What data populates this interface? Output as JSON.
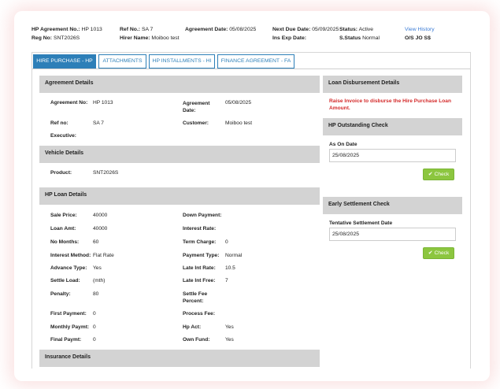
{
  "header": {
    "agreement_no_label": "HP Agreement No.:",
    "agreement_no": "HP 1013",
    "ref_no_label": "Ref No.:",
    "ref_no": "SA 7",
    "agreement_date_label": "Agreement Date:",
    "agreement_date": "05/08/2025",
    "next_due_label": "Next Due Date:",
    "next_due": "05/09/2025",
    "status_label": "Status:",
    "status": "Active",
    "view_history": "View History",
    "reg_no_label": "Reg No:",
    "reg_no": "SNT2026S",
    "hirer_label": "Hirer Name:",
    "hirer": "Moiboo test",
    "ins_exp_label": "Ins Exp Date:",
    "ins_exp": "",
    "s_status_label": "S.Status",
    "s_status": "Normal",
    "os_label": "O/S JO S$"
  },
  "tabs": [
    {
      "label": "HIRE PURCHASE - HP",
      "active": true
    },
    {
      "label": "ATTACHMENTS",
      "active": false
    },
    {
      "label": "HP INSTALLMENTS - HI",
      "active": false
    },
    {
      "label": "FINANCE AGREEMENT - FA",
      "active": false
    }
  ],
  "agreement_details": {
    "title": "Agreement Details",
    "agreement_no_label": "Agreement No:",
    "agreement_no": "HP 1013",
    "agreement_date_label": "Agreement Date:",
    "agreement_date": "05/08/2025",
    "ref_no_label": "Ref no:",
    "ref_no": "SA 7",
    "customer_label": "Customer:",
    "customer": "Moiboo test",
    "executive_label": "Executive:",
    "executive": ""
  },
  "vehicle_details": {
    "title": "Vehicle Details",
    "product_label": "Product:",
    "product": "SNT2026S"
  },
  "loan_details": {
    "title": "HP Loan Details",
    "rows": [
      {
        "l1": "Sale Price:",
        "v1": "40000",
        "l2": "Down Payment:",
        "v2": ""
      },
      {
        "l1": "Loan Amt:",
        "v1": "40000",
        "l2": "Interest Rate:",
        "v2": ""
      },
      {
        "l1": "No Months:",
        "v1": "60",
        "l2": "Term Charge:",
        "v2": "0"
      },
      {
        "l1": "Interest Method:",
        "v1": "Flat Rate",
        "l2": "Payment Type:",
        "v2": "Normal"
      },
      {
        "l1": "Advance Type:",
        "v1": "Yes",
        "l2": "Late Int Rate:",
        "v2": "10.5"
      },
      {
        "l1": "Settle Load:",
        "v1": "(mth)",
        "l2": "Late Int Free:",
        "v2": "7"
      },
      {
        "l1": "Penalty:",
        "v1": "80",
        "l2": "Settle Fee",
        "v2": ""
      },
      {
        "l1": "First Payment:",
        "v1": "0",
        "l2": "Process Fee:",
        "v2": ""
      },
      {
        "l1": "Monthly Paymt:",
        "v1": "0",
        "l2": "Hp Act:",
        "v2": "Yes"
      },
      {
        "l1": "Final Paymt:",
        "v1": "0",
        "l2": "Own Fund:",
        "v2": "Yes"
      }
    ],
    "settle_fee_line2": "Percent:"
  },
  "insurance_details": {
    "title": "Insurance Details"
  },
  "loan_disbursement": {
    "title": "Loan Disbursement Details",
    "message_line1": "Raise Invoice to disburse the Hire Purchase Loan",
    "message_line2": "Amount."
  },
  "outstanding_check": {
    "title": "HP Outstanding Check",
    "as_on_label": "As On Date",
    "as_on_value": "25/08/2025",
    "check_label": "Check"
  },
  "early_settlement": {
    "title": "Early Settlement Check",
    "tentative_label": "Tentative Settlement Date",
    "tentative_value": "25/08/2025",
    "check_label": "Check"
  },
  "colors": {
    "tab_blue": "#2d7fb8",
    "section_grey": "#d3d3d3",
    "warning_red": "#d42b2b",
    "check_green": "#8cc63f",
    "link_blue": "#3a7bd5"
  }
}
